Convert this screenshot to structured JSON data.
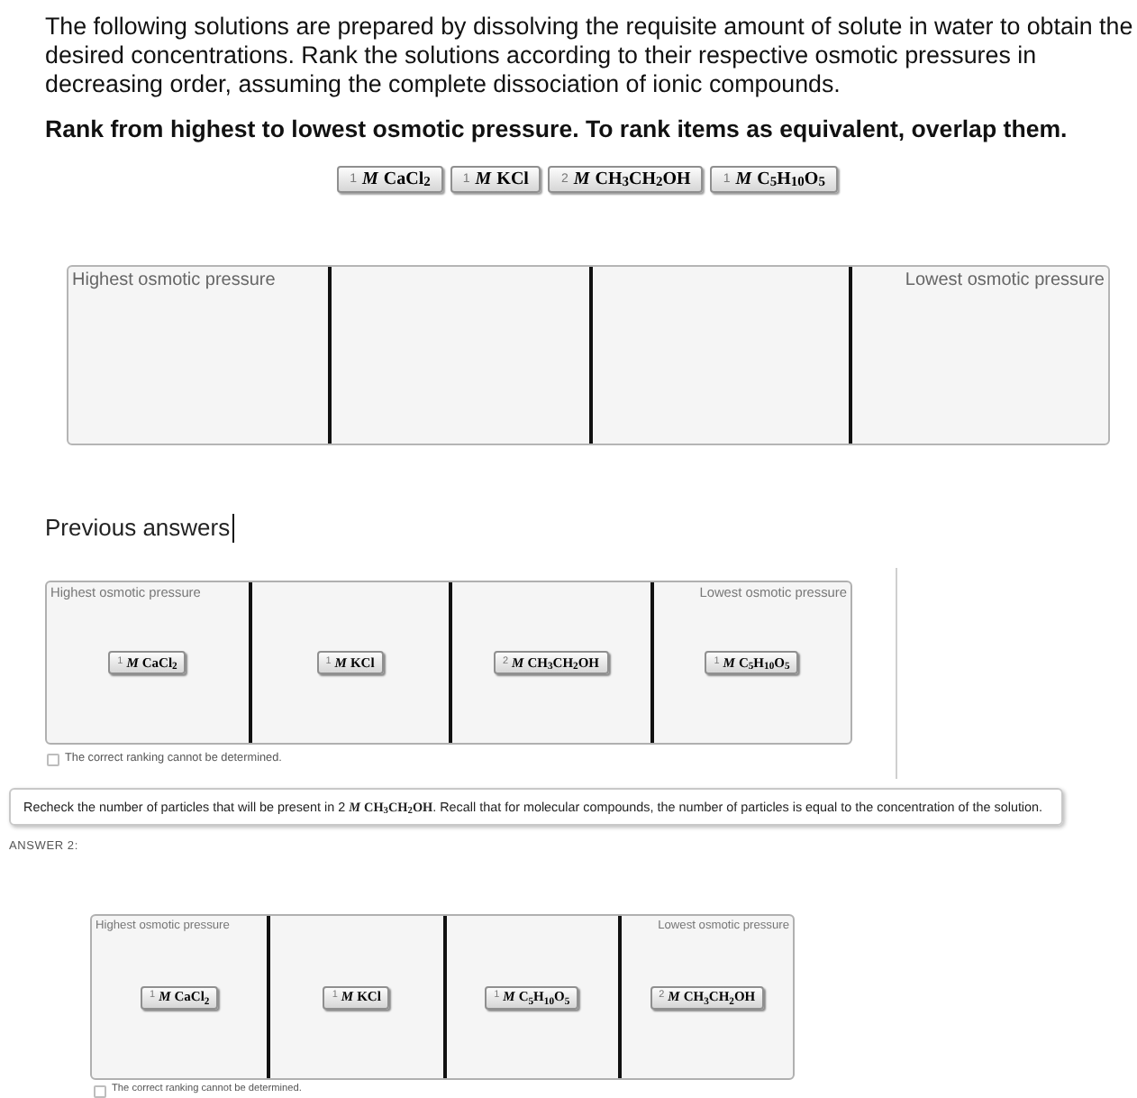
{
  "question": {
    "text": "The following solutions are prepared by dissolving the requisite amount of solute in water to obtain the desired concentrations. Rank the solutions according to their respective osmotic pressures in decreasing order, assuming the complete dissociation of ionic compounds.",
    "instruction": "Rank from highest to lowest osmotic pressure. To rank items as equivalent, overlap them."
  },
  "solutions": [
    {
      "coefficient": "1",
      "unit": "M",
      "formula": "CaCl$_{2}$"
    },
    {
      "coefficient": "1",
      "unit": "M",
      "formula": "KCl"
    },
    {
      "coefficient": "2",
      "unit": "M",
      "formula": "CH$_{3}$CH$_{2}$OH"
    },
    {
      "coefficient": "1",
      "unit": "M",
      "formula": "C$_{5}$H$_{10}$O$_{5}$"
    }
  ],
  "ranking_area": {
    "highest_label": "Highest osmotic pressure",
    "lowest_label": "Lowest osmotic pressure"
  },
  "previous_answers": {
    "title": "Previous answers",
    "text_cursor": true,
    "answers": [
      {
        "highest_label": "Highest osmotic pressure",
        "lowest_label": "Lowest osmotic pressure",
        "slots": [
          {
            "coefficient": "1",
            "unit": "M",
            "formula": "CaCl$_{2}$"
          },
          {
            "coefficient": "1",
            "unit": "M",
            "formula": "KCl"
          },
          {
            "coefficient": "2",
            "unit": "M",
            "formula": "CH$_{3}$CH$_{2}$OH"
          },
          {
            "coefficient": "1",
            "unit": "M",
            "formula": "C$_{5}$H$_{10}$O$_{5}$"
          }
        ],
        "checkbox": {
          "label": "The correct ranking cannot be determined.",
          "checked": false
        },
        "feedback": "Recheck the number of particles that will be present in 2 *M* **CH**$_{3}$**CH**$_{2}$**OH**. Recall that for molecular compounds, the number of particles is equal to the concentration of the solution."
      },
      {
        "heading": "ANSWER 2:",
        "highest_label": "Highest osmotic pressure",
        "lowest_label": "Lowest osmotic pressure",
        "slots": [
          {
            "coefficient": "1",
            "unit": "M",
            "formula": "CaCl$_{2}$"
          },
          {
            "coefficient": "1",
            "unit": "M",
            "formula": "KCl"
          },
          {
            "coefficient": "1",
            "unit": "M",
            "formula": "C$_{5}$H$_{10}$O$_{5}$"
          },
          {
            "coefficient": "2",
            "unit": "M",
            "formula": "CH$_{3}$CH$_{2}$OH"
          }
        ],
        "checkbox": {
          "label": "The correct ranking cannot be determined.",
          "checked": false
        }
      }
    ]
  }
}
